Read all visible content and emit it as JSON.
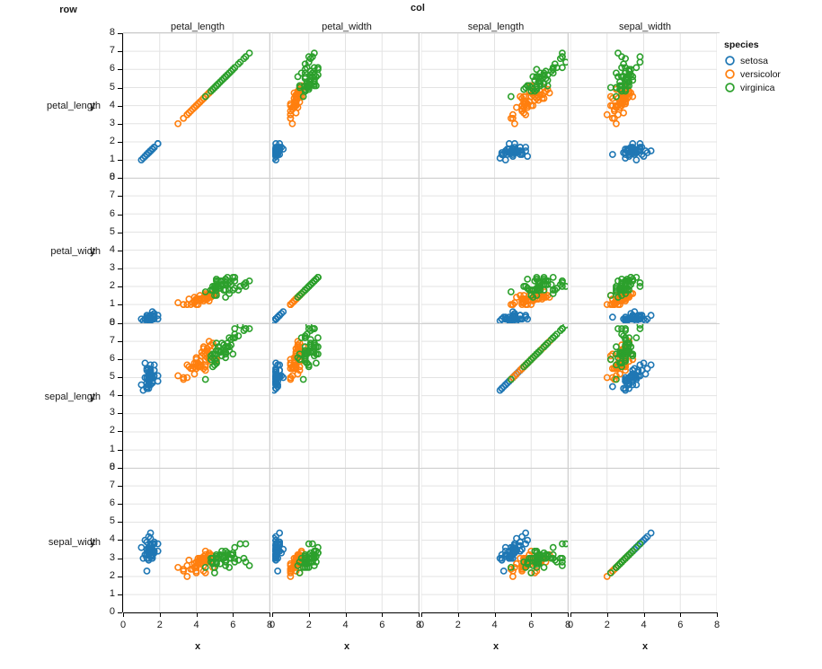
{
  "facet": {
    "col_super_label": "col",
    "row_super_label": "row",
    "col_labels": [
      "petal_length",
      "petal_width",
      "sepal_length",
      "sepal_width"
    ],
    "row_labels": [
      "petal_length",
      "petal_width",
      "sepal_length",
      "sepal_width"
    ]
  },
  "axes": {
    "x_title": "x",
    "y_title": "y",
    "x_ticks": [
      "0",
      "2",
      "4",
      "6",
      "8"
    ],
    "x_tick_values": [
      0,
      2,
      4,
      6,
      8
    ],
    "y_ticks": [
      "0",
      "1",
      "2",
      "3",
      "4",
      "5",
      "6",
      "7",
      "8"
    ],
    "y_tick_values": [
      0,
      1,
      2,
      3,
      4,
      5,
      6,
      7,
      8
    ],
    "xlim": [
      0,
      8
    ],
    "ylim": [
      0,
      8
    ]
  },
  "legend": {
    "title": "species",
    "items": [
      {
        "label": "setosa",
        "color": "#1f77b4"
      },
      {
        "label": "versicolor",
        "color": "#ff7f0e"
      },
      {
        "label": "virginica",
        "color": "#2ca02c"
      }
    ]
  },
  "colors": {
    "setosa": "#1f77b4",
    "versicolor": "#ff7f0e",
    "virginica": "#2ca02c",
    "grid": "#e3e3e3",
    "background": "#ffffff",
    "axis": "#000000",
    "separator": "#cfcfcf"
  },
  "chart_data": {
    "type": "scatter",
    "title": "",
    "layout": "scatter-plot-matrix",
    "grid": true,
    "legend_position": "right",
    "xlabel": "x",
    "ylabel": "y",
    "xlim": [
      0,
      8
    ],
    "ylim": [
      0,
      8
    ],
    "columns": [
      "petal_length",
      "petal_width",
      "sepal_length",
      "sepal_width"
    ],
    "rows": [
      "petal_length",
      "petal_width",
      "sepal_length",
      "sepal_width"
    ],
    "series": [
      {
        "name": "setosa",
        "color": "#1f77b4",
        "sepal_length": [
          5.1,
          4.9,
          4.7,
          4.6,
          5.0,
          5.4,
          4.6,
          5.0,
          4.4,
          4.9,
          5.4,
          4.8,
          4.8,
          4.3,
          5.8,
          5.7,
          5.4,
          5.1,
          5.7,
          5.1,
          5.4,
          5.1,
          4.6,
          5.1,
          4.8,
          5.0,
          5.0,
          5.2,
          5.2,
          4.7,
          4.8,
          5.4,
          5.2,
          5.5,
          4.9,
          5.0,
          5.5,
          4.9,
          4.4,
          5.1,
          5.0,
          4.5,
          4.4,
          5.0,
          5.1,
          4.8,
          5.1,
          4.6,
          5.3,
          5.0
        ],
        "sepal_width": [
          3.5,
          3.0,
          3.2,
          3.1,
          3.6,
          3.9,
          3.4,
          3.4,
          2.9,
          3.1,
          3.7,
          3.4,
          3.0,
          3.0,
          4.0,
          4.4,
          3.9,
          3.5,
          3.8,
          3.8,
          3.4,
          3.7,
          3.6,
          3.3,
          3.4,
          3.0,
          3.4,
          3.5,
          3.4,
          3.2,
          3.1,
          3.4,
          4.1,
          4.2,
          3.1,
          3.2,
          3.5,
          3.6,
          3.0,
          3.4,
          3.5,
          2.3,
          3.2,
          3.5,
          3.8,
          3.0,
          3.8,
          3.2,
          3.7,
          3.3
        ],
        "petal_length": [
          1.4,
          1.4,
          1.3,
          1.5,
          1.4,
          1.7,
          1.4,
          1.5,
          1.4,
          1.5,
          1.5,
          1.6,
          1.4,
          1.1,
          1.2,
          1.5,
          1.3,
          1.4,
          1.7,
          1.5,
          1.7,
          1.5,
          1.0,
          1.7,
          1.9,
          1.6,
          1.6,
          1.5,
          1.4,
          1.6,
          1.6,
          1.5,
          1.5,
          1.4,
          1.5,
          1.2,
          1.3,
          1.4,
          1.3,
          1.5,
          1.3,
          1.3,
          1.3,
          1.6,
          1.9,
          1.4,
          1.6,
          1.4,
          1.5,
          1.4
        ],
        "petal_width": [
          0.2,
          0.2,
          0.2,
          0.2,
          0.2,
          0.4,
          0.3,
          0.2,
          0.2,
          0.1,
          0.2,
          0.2,
          0.1,
          0.1,
          0.2,
          0.4,
          0.4,
          0.3,
          0.3,
          0.3,
          0.2,
          0.4,
          0.2,
          0.5,
          0.2,
          0.2,
          0.4,
          0.2,
          0.2,
          0.2,
          0.2,
          0.4,
          0.1,
          0.2,
          0.2,
          0.2,
          0.2,
          0.1,
          0.2,
          0.2,
          0.3,
          0.3,
          0.2,
          0.6,
          0.4,
          0.3,
          0.2,
          0.2,
          0.2,
          0.2
        ]
      },
      {
        "name": "versicolor",
        "color": "#ff7f0e",
        "sepal_length": [
          7.0,
          6.4,
          6.9,
          5.5,
          6.5,
          5.7,
          6.3,
          4.9,
          6.6,
          5.2,
          5.0,
          5.9,
          6.0,
          6.1,
          5.6,
          6.7,
          5.6,
          5.8,
          6.2,
          5.6,
          5.9,
          6.1,
          6.3,
          6.1,
          6.4,
          6.6,
          6.8,
          6.7,
          6.0,
          5.7,
          5.5,
          5.5,
          5.8,
          6.0,
          5.4,
          6.0,
          6.7,
          6.3,
          5.6,
          5.5,
          5.5,
          6.1,
          5.8,
          5.0,
          5.6,
          5.7,
          5.7,
          6.2,
          5.1,
          5.7
        ],
        "sepal_width": [
          3.2,
          3.2,
          3.1,
          2.3,
          2.8,
          2.8,
          3.3,
          2.4,
          2.9,
          2.7,
          2.0,
          3.0,
          2.2,
          2.9,
          2.9,
          3.1,
          3.0,
          2.7,
          2.2,
          2.5,
          3.2,
          2.8,
          2.5,
          2.8,
          2.9,
          3.0,
          2.8,
          3.0,
          2.9,
          2.6,
          2.4,
          2.4,
          2.7,
          2.7,
          3.0,
          3.4,
          3.1,
          2.3,
          3.0,
          2.5,
          2.6,
          3.0,
          2.6,
          2.3,
          2.7,
          3.0,
          2.9,
          2.9,
          2.5,
          2.8
        ],
        "petal_length": [
          4.7,
          4.5,
          4.9,
          4.0,
          4.6,
          4.5,
          4.7,
          3.3,
          4.6,
          3.9,
          3.5,
          4.2,
          4.0,
          4.7,
          3.6,
          4.4,
          4.5,
          4.1,
          4.5,
          3.9,
          4.8,
          4.0,
          4.9,
          4.7,
          4.3,
          4.4,
          4.8,
          5.0,
          4.5,
          3.5,
          3.8,
          3.7,
          3.9,
          5.1,
          4.5,
          4.5,
          4.7,
          4.4,
          4.1,
          4.0,
          4.4,
          4.6,
          4.0,
          3.3,
          4.2,
          4.2,
          4.2,
          4.3,
          3.0,
          4.1
        ],
        "petal_width": [
          1.4,
          1.5,
          1.5,
          1.3,
          1.5,
          1.3,
          1.6,
          1.0,
          1.3,
          1.4,
          1.0,
          1.5,
          1.0,
          1.4,
          1.3,
          1.4,
          1.5,
          1.0,
          1.5,
          1.1,
          1.8,
          1.3,
          1.5,
          1.2,
          1.3,
          1.4,
          1.4,
          1.7,
          1.5,
          1.0,
          1.1,
          1.0,
          1.2,
          1.6,
          1.5,
          1.6,
          1.5,
          1.3,
          1.3,
          1.3,
          1.2,
          1.4,
          1.2,
          1.0,
          1.3,
          1.2,
          1.3,
          1.3,
          1.1,
          1.3
        ]
      },
      {
        "name": "virginica",
        "color": "#2ca02c",
        "sepal_length": [
          6.3,
          5.8,
          7.1,
          6.3,
          6.5,
          7.6,
          4.9,
          7.3,
          6.7,
          7.2,
          6.5,
          6.4,
          6.8,
          5.7,
          5.8,
          6.4,
          6.5,
          7.7,
          7.7,
          6.0,
          6.9,
          5.6,
          7.7,
          6.3,
          6.7,
          7.2,
          6.2,
          6.1,
          6.4,
          7.2,
          7.4,
          7.9,
          6.4,
          6.3,
          6.1,
          7.7,
          6.3,
          6.4,
          6.0,
          6.9,
          6.7,
          6.9,
          5.8,
          6.8,
          6.7,
          6.7,
          6.3,
          6.5,
          6.2,
          5.9
        ],
        "sepal_width": [
          3.3,
          2.7,
          3.0,
          2.9,
          3.0,
          3.0,
          2.5,
          2.9,
          2.5,
          3.6,
          3.2,
          2.7,
          3.0,
          2.5,
          2.8,
          3.2,
          3.0,
          3.8,
          2.6,
          2.2,
          3.2,
          2.8,
          2.8,
          2.7,
          3.3,
          3.2,
          2.8,
          3.0,
          2.8,
          3.0,
          2.8,
          3.8,
          2.8,
          2.8,
          2.6,
          3.0,
          3.4,
          3.1,
          3.0,
          3.1,
          3.1,
          3.1,
          2.7,
          3.2,
          3.3,
          3.0,
          2.5,
          3.0,
          3.4,
          3.0
        ],
        "petal_length": [
          6.0,
          5.1,
          5.9,
          5.6,
          5.8,
          6.6,
          4.5,
          6.3,
          5.8,
          6.1,
          5.1,
          5.3,
          5.5,
          5.0,
          5.1,
          5.3,
          5.5,
          6.7,
          6.9,
          5.0,
          5.7,
          4.9,
          6.7,
          4.9,
          5.7,
          6.0,
          4.8,
          4.9,
          5.6,
          5.8,
          6.1,
          6.4,
          5.6,
          5.1,
          5.6,
          6.1,
          5.6,
          5.5,
          4.8,
          5.4,
          5.6,
          5.1,
          5.1,
          5.9,
          5.7,
          5.2,
          5.0,
          5.2,
          5.4,
          5.1
        ],
        "petal_width": [
          2.5,
          1.9,
          2.1,
          1.8,
          2.2,
          2.1,
          1.7,
          1.8,
          1.8,
          2.5,
          2.0,
          1.9,
          2.1,
          2.0,
          2.4,
          2.3,
          1.8,
          2.2,
          2.3,
          1.5,
          2.3,
          2.0,
          2.0,
          1.8,
          2.1,
          1.8,
          1.8,
          1.8,
          2.1,
          1.6,
          1.9,
          2.0,
          2.2,
          1.5,
          1.4,
          2.3,
          2.4,
          1.8,
          1.8,
          2.1,
          2.4,
          2.3,
          1.9,
          2.3,
          2.5,
          2.3,
          1.9,
          2.0,
          2.3,
          1.8
        ]
      }
    ]
  }
}
